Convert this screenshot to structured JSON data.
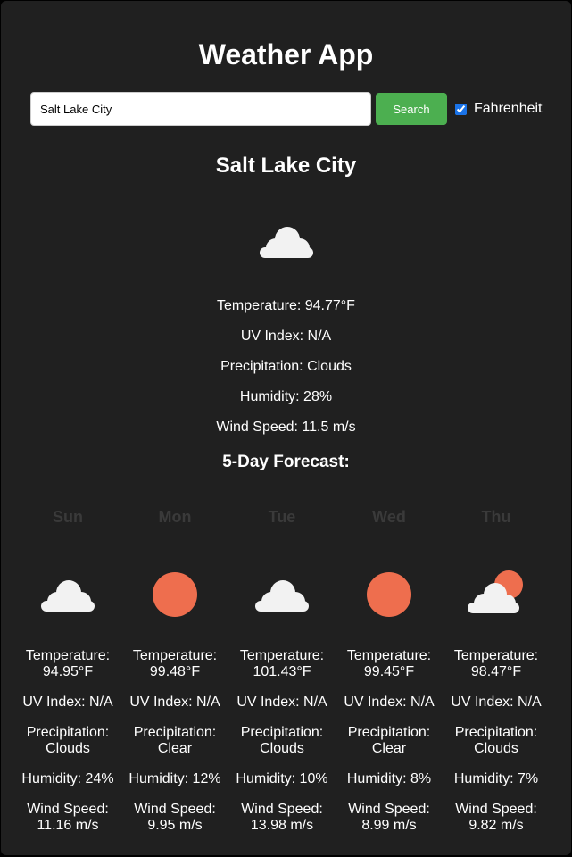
{
  "header": {
    "title": "Weather App"
  },
  "search": {
    "value": "Salt Lake City",
    "button_label": "Search",
    "unit_label": "Fahrenheit",
    "unit_checked": true
  },
  "current": {
    "city": "Salt Lake City",
    "icon": "cloud-icon",
    "temperature": "Temperature: 94.77°F",
    "uv": "UV Index: N/A",
    "precipitation": "Precipitation: Clouds",
    "humidity": "Humidity: 28%",
    "wind": "Wind Speed: 11.5 m/s"
  },
  "forecast": {
    "title": "5-Day Forecast:",
    "days": [
      {
        "name": "Sun",
        "icon": "cloud-icon",
        "temp_label": "Temperature:",
        "temp_value": "94.95°F",
        "uv": "UV Index: N/A",
        "prec_label": "Precipitation:",
        "prec_value": "Clouds",
        "humidity": "Humidity: 24%",
        "wind_label": "Wind Speed:",
        "wind_value": "11.16 m/s"
      },
      {
        "name": "Mon",
        "icon": "sun-icon",
        "temp_label": "Temperature:",
        "temp_value": "99.48°F",
        "uv": "UV Index: N/A",
        "prec_label": "Precipitation:",
        "prec_value": "Clear",
        "humidity": "Humidity: 12%",
        "wind_label": "Wind Speed:",
        "wind_value": "9.95 m/s"
      },
      {
        "name": "Tue",
        "icon": "cloud-icon",
        "temp_label": "Temperature:",
        "temp_value": "101.43°F",
        "uv": "UV Index: N/A",
        "prec_label": "Precipitation:",
        "prec_value": "Clouds",
        "humidity": "Humidity: 10%",
        "wind_label": "Wind Speed:",
        "wind_value": "13.98 m/s"
      },
      {
        "name": "Wed",
        "icon": "sun-icon",
        "temp_label": "Temperature:",
        "temp_value": "99.45°F",
        "uv": "UV Index: N/A",
        "prec_label": "Precipitation:",
        "prec_value": "Clear",
        "humidity": "Humidity: 8%",
        "wind_label": "Wind Speed:",
        "wind_value": "8.99 m/s"
      },
      {
        "name": "Thu",
        "icon": "partly-cloudy-icon",
        "temp_label": "Temperature:",
        "temp_value": "98.47°F",
        "uv": "UV Index: N/A",
        "prec_label": "Precipitation:",
        "prec_value": "Clouds",
        "humidity": "Humidity: 7%",
        "wind_label": "Wind Speed:",
        "wind_value": "9.82 m/s"
      }
    ]
  },
  "colors": {
    "background": "#202020",
    "button": "#4caf50",
    "sun": "#ee6e4e",
    "cloud": "#f2f2f2",
    "day_name": "#3a3a3a"
  }
}
